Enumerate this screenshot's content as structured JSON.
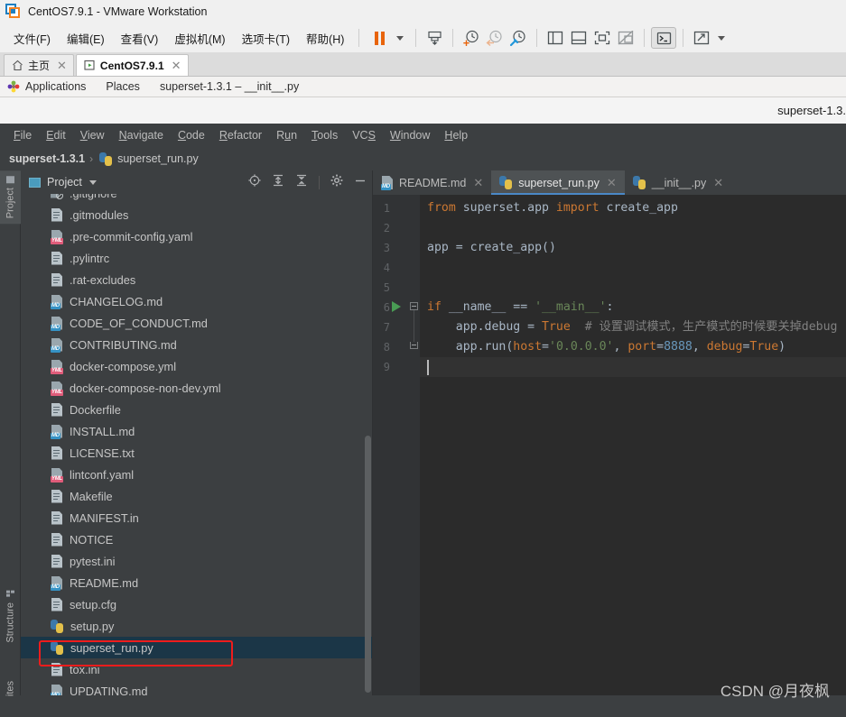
{
  "vmware": {
    "title": "CentOS7.9.1 - VMware Workstation",
    "logo_icon": "vmware-logo-icon",
    "menus": [
      {
        "label": "文件(F)",
        "name": "menu-file"
      },
      {
        "label": "编辑(E)",
        "name": "menu-edit"
      },
      {
        "label": "查看(V)",
        "name": "menu-view"
      },
      {
        "label": "虚拟机(M)",
        "name": "menu-vm"
      },
      {
        "label": "选项卡(T)",
        "name": "menu-tabs"
      },
      {
        "label": "帮助(H)",
        "name": "menu-help"
      }
    ],
    "toolbar_icons": [
      "pause-icon",
      "dropdown-caret-icon",
      "send-ctrl-alt-del-icon",
      "snapshot-take-icon",
      "snapshot-revert-icon",
      "snapshot-manager-icon",
      "show-sidebar-icon",
      "show-bottom-panel-icon",
      "fullscreen-icon",
      "unity-mode-icon",
      "console-icon",
      "expand-icon",
      "expand-caret-icon"
    ],
    "tabs": [
      {
        "label": "主页",
        "icon": "home-icon",
        "active": false,
        "name": "vm-tab-home"
      },
      {
        "label": "CentOS7.9.1",
        "icon": "vm-screen-icon",
        "active": true,
        "name": "vm-tab-centos"
      }
    ]
  },
  "gnome": {
    "applications": "Applications",
    "places": "Places",
    "active_window": "superset-1.3.1 – __init__.py",
    "app_icon": "gnome-applications-icon"
  },
  "window_strip": {
    "title": "superset-1.3."
  },
  "ide": {
    "menus": [
      {
        "pre": "",
        "accel": "F",
        "post": "ile",
        "name": "ide-menu-file"
      },
      {
        "pre": "",
        "accel": "E",
        "post": "dit",
        "name": "ide-menu-edit"
      },
      {
        "pre": "",
        "accel": "V",
        "post": "iew",
        "name": "ide-menu-view"
      },
      {
        "pre": "",
        "accel": "N",
        "post": "avigate",
        "name": "ide-menu-navigate"
      },
      {
        "pre": "",
        "accel": "C",
        "post": "ode",
        "name": "ide-menu-code"
      },
      {
        "pre": "",
        "accel": "R",
        "post": "efactor",
        "name": "ide-menu-refactor"
      },
      {
        "pre": "R",
        "accel": "u",
        "post": "n",
        "name": "ide-menu-run"
      },
      {
        "pre": "",
        "accel": "T",
        "post": "ools",
        "name": "ide-menu-tools"
      },
      {
        "pre": "VC",
        "accel": "S",
        "post": "",
        "name": "ide-menu-vcs"
      },
      {
        "pre": "",
        "accel": "W",
        "post": "indow",
        "name": "ide-menu-window"
      },
      {
        "pre": "",
        "accel": "H",
        "post": "elp",
        "name": "ide-menu-help"
      }
    ],
    "breadcrumb": {
      "project": "superset-1.3.1",
      "separator": "›",
      "file": "superset_run.py",
      "file_icon": "python-file-icon"
    },
    "left_rail": [
      {
        "label": "Project",
        "name": "rail-project",
        "selected": true,
        "icon": "folder-icon"
      },
      {
        "label": "Structure",
        "name": "rail-structure",
        "selected": false,
        "icon": "structure-icon"
      },
      {
        "label": "ites",
        "name": "rail-favorites",
        "selected": false,
        "icon": "star-icon"
      }
    ]
  },
  "project_panel": {
    "title": "Project",
    "view_icon": "project-view-icon",
    "chevron_icon": "chevron-down-icon",
    "actions": [
      {
        "name": "locate-file-icon",
        "label": "target-icon"
      },
      {
        "name": "expand-all-icon",
        "label": "expand-all"
      },
      {
        "name": "collapse-all-icon",
        "label": "collapse-all"
      },
      {
        "name": "settings-gear-icon",
        "label": "gear"
      },
      {
        "name": "hide-panel-icon",
        "label": "minus"
      }
    ],
    "files": [
      {
        "name": ".gitignore",
        "icon": "gitignore-icon",
        "selected": false,
        "clipped": true
      },
      {
        "name": ".gitmodules",
        "icon": "text-file-icon",
        "selected": false
      },
      {
        "name": ".pre-commit-config.yaml",
        "icon": "yaml-file-icon",
        "selected": false
      },
      {
        "name": ".pylintrc",
        "icon": "text-file-icon",
        "selected": false
      },
      {
        "name": ".rat-excludes",
        "icon": "text-file-icon",
        "selected": false
      },
      {
        "name": "CHANGELOG.md",
        "icon": "markdown-file-icon",
        "selected": false
      },
      {
        "name": "CODE_OF_CONDUCT.md",
        "icon": "markdown-file-icon",
        "selected": false
      },
      {
        "name": "CONTRIBUTING.md",
        "icon": "markdown-file-icon",
        "selected": false
      },
      {
        "name": "docker-compose.yml",
        "icon": "yaml-file-icon",
        "selected": false
      },
      {
        "name": "docker-compose-non-dev.yml",
        "icon": "yaml-file-icon",
        "selected": false
      },
      {
        "name": "Dockerfile",
        "icon": "text-file-icon",
        "selected": false
      },
      {
        "name": "INSTALL.md",
        "icon": "markdown-file-icon",
        "selected": false
      },
      {
        "name": "LICENSE.txt",
        "icon": "text-file-icon",
        "selected": false
      },
      {
        "name": "lintconf.yaml",
        "icon": "yaml-file-icon",
        "selected": false
      },
      {
        "name": "Makefile",
        "icon": "text-file-icon",
        "selected": false
      },
      {
        "name": "MANIFEST.in",
        "icon": "text-file-icon",
        "selected": false
      },
      {
        "name": "NOTICE",
        "icon": "text-file-icon",
        "selected": false
      },
      {
        "name": "pytest.ini",
        "icon": "text-file-icon",
        "selected": false
      },
      {
        "name": "README.md",
        "icon": "markdown-file-icon",
        "selected": false
      },
      {
        "name": "setup.cfg",
        "icon": "text-file-icon",
        "selected": false
      },
      {
        "name": "setup.py",
        "icon": "python-file-icon",
        "selected": false
      },
      {
        "name": "superset_run.py",
        "icon": "python-file-icon",
        "selected": true,
        "highlighted": true
      },
      {
        "name": "tox.ini",
        "icon": "text-file-icon",
        "selected": false
      },
      {
        "name": "UPDATING.md",
        "icon": "markdown-file-icon",
        "selected": false
      }
    ],
    "annotation_color": "#ee1c1c"
  },
  "editor": {
    "tabs": [
      {
        "label": "README.md",
        "icon": "markdown-file-icon",
        "active": false,
        "name": "editor-tab-readme"
      },
      {
        "label": "superset_run.py",
        "icon": "python-file-icon",
        "active": true,
        "name": "editor-tab-superset-run"
      },
      {
        "label": "__init__.py",
        "icon": "python-file-icon",
        "active": false,
        "name": "editor-tab-init"
      }
    ],
    "active_tab_accent": "#4a88c7",
    "line_numbers": [
      "1",
      "2",
      "3",
      "4",
      "5",
      "6",
      "7",
      "8",
      "9"
    ],
    "gutter": {
      "run_marker_line": 6,
      "fold_start_line": 6,
      "fold_end_line": 8
    },
    "code_lines": [
      {
        "n": 1,
        "tokens": [
          {
            "t": "from ",
            "c": "k-kw"
          },
          {
            "t": "superset.app ",
            "c": "k-def"
          },
          {
            "t": "import ",
            "c": "k-kw"
          },
          {
            "t": "create_app",
            "c": "k-def"
          }
        ]
      },
      {
        "n": 2,
        "tokens": []
      },
      {
        "n": 3,
        "tokens": [
          {
            "t": "app = create_app()",
            "c": "k-def"
          }
        ]
      },
      {
        "n": 4,
        "tokens": []
      },
      {
        "n": 5,
        "tokens": []
      },
      {
        "n": 6,
        "tokens": [
          {
            "t": "if ",
            "c": "k-kw"
          },
          {
            "t": "__name__ == ",
            "c": "k-def"
          },
          {
            "t": "'__main__'",
            "c": "k-str"
          },
          {
            "t": ":",
            "c": "k-def"
          }
        ]
      },
      {
        "n": 7,
        "tokens": [
          {
            "t": "    app.debug = ",
            "c": "k-def"
          },
          {
            "t": "True",
            "c": "k-kw"
          },
          {
            "t": "  ",
            "c": "k-def"
          },
          {
            "t": "# 设置调试模式，生产模式的时候要关掉debug",
            "c": "k-com"
          }
        ]
      },
      {
        "n": 8,
        "tokens": [
          {
            "t": "    app.run(",
            "c": "k-def"
          },
          {
            "t": "host",
            "c": "k-par"
          },
          {
            "t": "=",
            "c": "k-def"
          },
          {
            "t": "'0.0.0.0'",
            "c": "k-str"
          },
          {
            "t": ", ",
            "c": "k-def"
          },
          {
            "t": "port",
            "c": "k-par"
          },
          {
            "t": "=",
            "c": "k-def"
          },
          {
            "t": "8888",
            "c": "k-num"
          },
          {
            "t": ", ",
            "c": "k-def"
          },
          {
            "t": "debug",
            "c": "k-par"
          },
          {
            "t": "=",
            "c": "k-def"
          },
          {
            "t": "True",
            "c": "k-kw"
          },
          {
            "t": ")",
            "c": "k-def"
          }
        ]
      },
      {
        "n": 9,
        "tokens": []
      }
    ],
    "cursor_line": 9
  },
  "watermark": "CSDN @月夜枫"
}
